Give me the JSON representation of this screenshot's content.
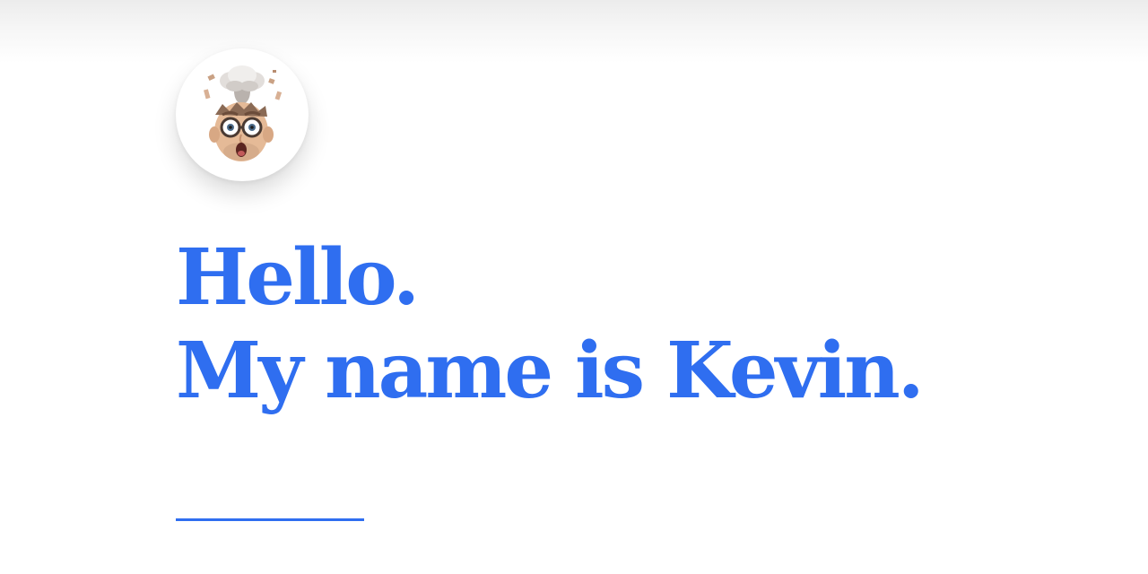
{
  "avatar": {
    "icon": "exploding-head-memoji-icon"
  },
  "hero": {
    "line1": "Hello.",
    "line2": "My name is Kevin."
  },
  "colors": {
    "accent": "#2f6ef0",
    "background": "#ffffff"
  }
}
